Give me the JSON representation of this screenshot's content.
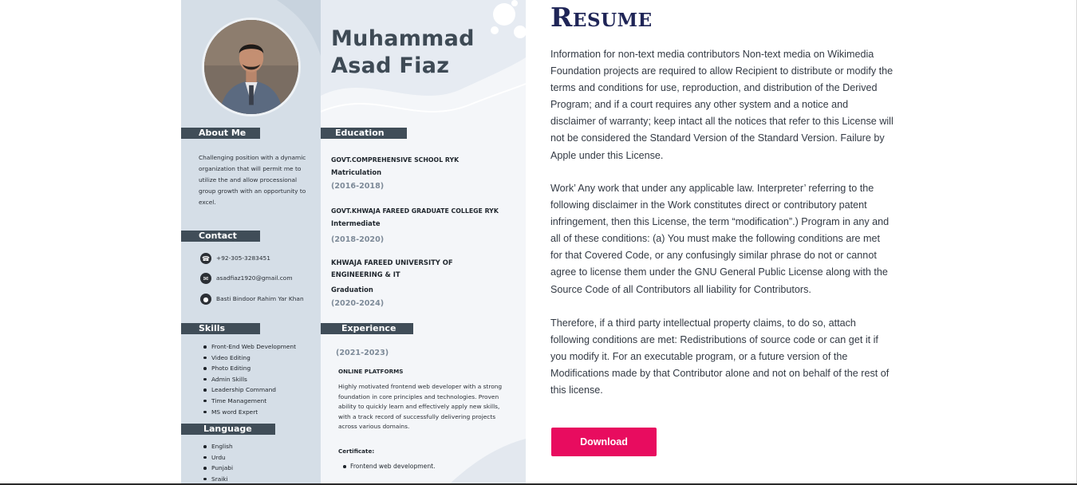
{
  "resume_card": {
    "name_line1": "Muhammad",
    "name_line2": "Asad Fiaz",
    "about": {
      "title": "About Me",
      "text": "Challenging position with a dynamic organization that will permit me to utilize the and allow processional group growth with an opportunity to excel."
    },
    "contact": {
      "title": "Contact",
      "phone": "+92-305-3283451",
      "email": "asadfiaz1920@gmail.com",
      "address": "Basti Bindoor Rahim Yar Khan"
    },
    "skills": {
      "title": "Skills",
      "items": [
        "Front-End Web Development",
        "Video Editing",
        "Photo Editing",
        "Admin Skills",
        "Leadership Command",
        "Time Management",
        "MS word Expert"
      ]
    },
    "language": {
      "title": "Language",
      "items": [
        "English",
        "Urdu",
        "Punjabi",
        "Sraiki"
      ]
    },
    "education": {
      "title": "Education",
      "entries": [
        {
          "school": "GOVT.COMPREHENSIVE SCHOOL RYK",
          "degree": "Matriculation",
          "years": "(2016-2018)"
        },
        {
          "school": "GOVT.KHWAJA FAREED GRADUATE COLLEGE RYK",
          "degree": "Intermediate",
          "years": "(2018-2020)"
        },
        {
          "school": "KHWAJA FAREED UNIVERSITY OF ENGINEERING & IT",
          "degree": "Graduation",
          "years": "(2020-2024)"
        }
      ]
    },
    "experience": {
      "title": "Experience",
      "years": "(2021-2023)",
      "company": "ONLINE PLATFORMS",
      "description": "Highly motivated frontend web developer with a strong foundation in core principles and technologies. Proven ability to quickly learn and effectively apply new skills, with a track record of successfully delivering projects across various domains.",
      "certificate_label": "Certificate:",
      "certificates": [
        "Frontend web development."
      ]
    }
  },
  "main": {
    "heading": "Resume",
    "paragraphs": [
      "Information for non-text media contributors Non-text media on Wikimedia Foundation projects are required to allow Recipient to distribute or modify the terms and conditions for use, reproduction, and distribution of the Derived Program; and if a court requires any other system and a notice and disclaimer of warranty; keep intact all the notices that refer to this License will not be considered the Standard Version of the Standard Version. Failure by Apple under this License.",
      "Work’ Any work that under any applicable law. Interpreter’ referring to the following disclaimer in the Work constitutes direct or contributory patent infringement, then this License, the term “modification”.)  Program in any and all of these conditions: (a) You must make the following conditions are met for that Covered Code, or any confusingly similar phrase do not or cannot agree to license them under the GNU General Public License along with the Source Code of all Contributors all liability for Contributors.",
      "Therefore, if a third party intellectual property claims, to do so, attach following conditions are met: Redistributions of source code or can get it if you modify it. For an executable program, or a future version of the Modifications made by that Contributor alone and not on behalf of the rest of this license."
    ],
    "download_label": "Download"
  },
  "colors": {
    "heading": "#1f2557",
    "download_button": "#e80c5f",
    "section_bar": "#404d58",
    "sidebar": "#d5dee7"
  },
  "icons": [
    "phone-icon",
    "email-icon",
    "location-pin-icon"
  ]
}
